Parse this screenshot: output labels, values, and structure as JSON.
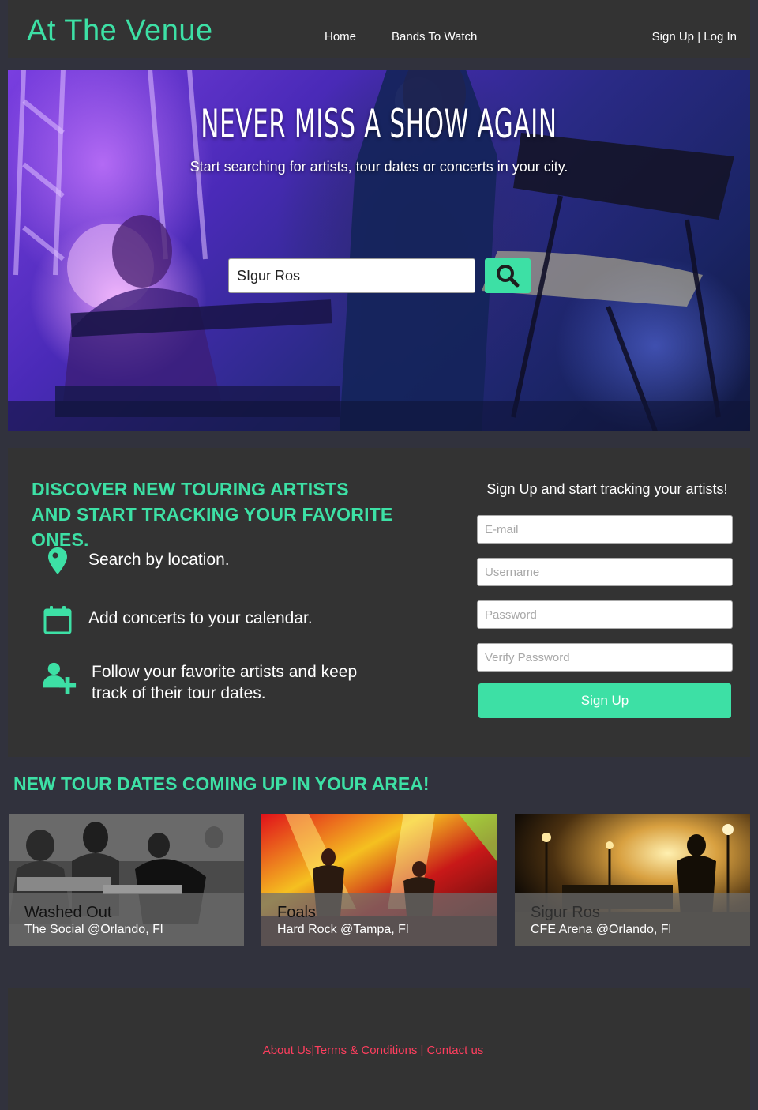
{
  "header": {
    "logo": "At The Venue",
    "nav": {
      "home": "Home",
      "bands": "Bands To Watch"
    },
    "sign_up": "Sign Up",
    "separator": "|",
    "log_in": "Log In"
  },
  "hero": {
    "title": "NEVER MISS A SHOW AGAIN",
    "subtitle": "Start searching for artists, tour dates or concerts in your city.",
    "search_value": "SIgur Ros",
    "search_icon": "search-icon"
  },
  "features": {
    "heading_line1": "DISCOVER NEW TOURING ARTISTS",
    "heading_line2": "AND START TRACKING YOUR FAVORITE ONES.",
    "items": [
      {
        "icon": "location-pin-icon",
        "text": "Search by location."
      },
      {
        "icon": "calendar-icon",
        "text": "Add concerts to your calendar."
      },
      {
        "icon": "add-user-icon",
        "text": "Follow your favorite artists and keep track of their tour dates."
      }
    ]
  },
  "signup": {
    "title": "Sign Up and start tracking your artists!",
    "email_placeholder": "E-mail",
    "username_placeholder": "Username",
    "password_placeholder": "Password",
    "verify_placeholder": "Verify Password",
    "button": "Sign Up"
  },
  "tour": {
    "heading": "NEW TOUR DATES COMING UP IN YOUR AREA!",
    "cards": [
      {
        "band": "Washed Out",
        "venue": "The Social @Orlando, Fl"
      },
      {
        "band": "Foals",
        "venue": "Hard Rock @Tampa, Fl"
      },
      {
        "band": "Sigur Ros",
        "venue": "CFE Arena @Orlando, Fl"
      }
    ]
  },
  "footer": {
    "about": "About Us",
    "sep1": "|",
    "terms": "Terms & Conditions",
    "sep2": " | ",
    "contact": "Contact us"
  },
  "colors": {
    "accent": "#3de0a5",
    "page_bg": "#31323d",
    "panel_bg": "#333333",
    "footer_link": "#ff3e5e"
  }
}
